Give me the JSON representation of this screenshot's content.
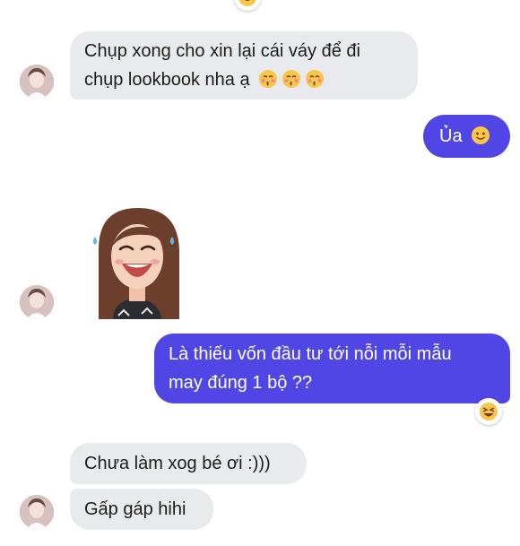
{
  "conversation": {
    "messages": [
      {
        "sender": "other",
        "lines": [
          "Chụp xong cho xin lại cái váy để đi",
          "chụp lookbook nha ạ"
        ],
        "inline_emoji": [
          "kissing-closed-eyes",
          "kissing-closed-eyes",
          "kissing-closed-eyes"
        ]
      },
      {
        "sender": "me",
        "text": "Ủa",
        "inline_emoji": [
          "slightly-smiling-face"
        ]
      },
      {
        "sender": "other",
        "sticker": "memoji-laughing-with-tears"
      },
      {
        "sender": "me",
        "lines": [
          "Là thiếu vốn đầu tư tới nỗi mỗi mẫu",
          "may đúng 1 bộ ??"
        ],
        "reaction": "laughing-squint"
      },
      {
        "sender": "other",
        "text": "Chưa làm xog bé ơi :)))"
      },
      {
        "sender": "other",
        "text": "Gấp gáp hihi"
      }
    ]
  },
  "colors": {
    "outgoing_bubble": "#5046e6",
    "incoming_bubble": "#e9eaed",
    "text_dark": "#1c1c1e",
    "text_light": "#ffffff"
  }
}
